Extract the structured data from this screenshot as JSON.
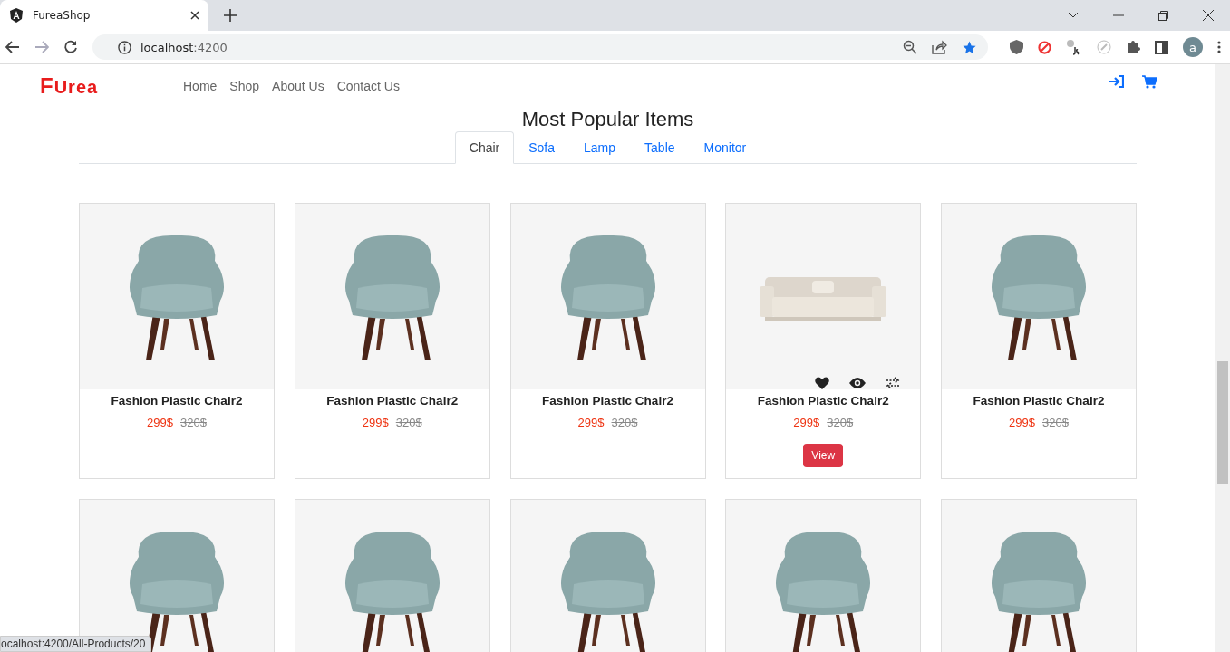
{
  "browser": {
    "tab_title": "FureaShop",
    "url_host": "localhost",
    "url_port": ":4200",
    "profile_initial": "a"
  },
  "navbar": {
    "logo_initial": "F",
    "logo_rest": "Urea",
    "links": [
      "Home",
      "Shop",
      "About Us",
      "Contact Us"
    ]
  },
  "section": {
    "heading": "Most Popular Items"
  },
  "tabs": [
    {
      "label": "Chair",
      "selected": true
    },
    {
      "label": "Sofa",
      "selected": false
    },
    {
      "label": "Lamp",
      "selected": false
    },
    {
      "label": "Table",
      "selected": false
    },
    {
      "label": "Monitor",
      "selected": false
    }
  ],
  "products": [
    {
      "kind": "chair",
      "title": "Fashion Plastic Chair2",
      "price": "299$",
      "old_price": "320$",
      "hovered": false
    },
    {
      "kind": "chair",
      "title": "Fashion Plastic Chair2",
      "price": "299$",
      "old_price": "320$",
      "hovered": false
    },
    {
      "kind": "chair",
      "title": "Fashion Plastic Chair2",
      "price": "299$",
      "old_price": "320$",
      "hovered": false
    },
    {
      "kind": "sofa",
      "title": "Fashion Plastic Chair2",
      "price": "299$",
      "old_price": "320$",
      "hovered": true,
      "button": "View"
    },
    {
      "kind": "chair",
      "title": "Fashion Plastic Chair2",
      "price": "299$",
      "old_price": "320$",
      "hovered": false
    }
  ],
  "more_products": [
    {
      "kind": "chair"
    },
    {
      "kind": "chair"
    },
    {
      "kind": "chair"
    },
    {
      "kind": "chair"
    },
    {
      "kind": "chair"
    }
  ],
  "status_bar": {
    "link": "ocalhost:4200/All-Products/20"
  }
}
